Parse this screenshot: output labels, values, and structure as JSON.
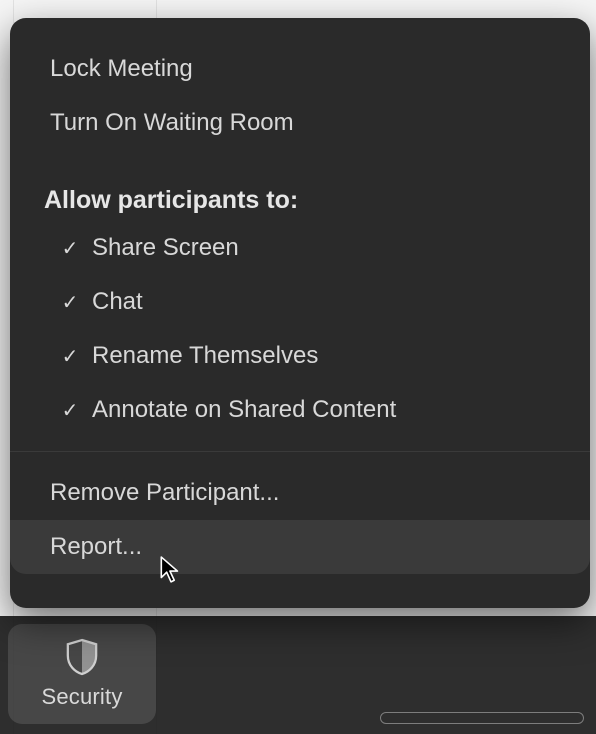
{
  "toolbar": {
    "security_label": "Security"
  },
  "menu": {
    "lock_meeting": "Lock Meeting",
    "waiting_room": "Turn On Waiting Room",
    "allow_heading": "Allow participants to:",
    "allow": [
      {
        "label": "Share Screen",
        "checked": true
      },
      {
        "label": "Chat",
        "checked": true
      },
      {
        "label": "Rename Themselves",
        "checked": true
      },
      {
        "label": "Annotate on Shared Content",
        "checked": true
      }
    ],
    "remove_participant": "Remove Participant...",
    "report": "Report...",
    "hovered_item": "report"
  }
}
